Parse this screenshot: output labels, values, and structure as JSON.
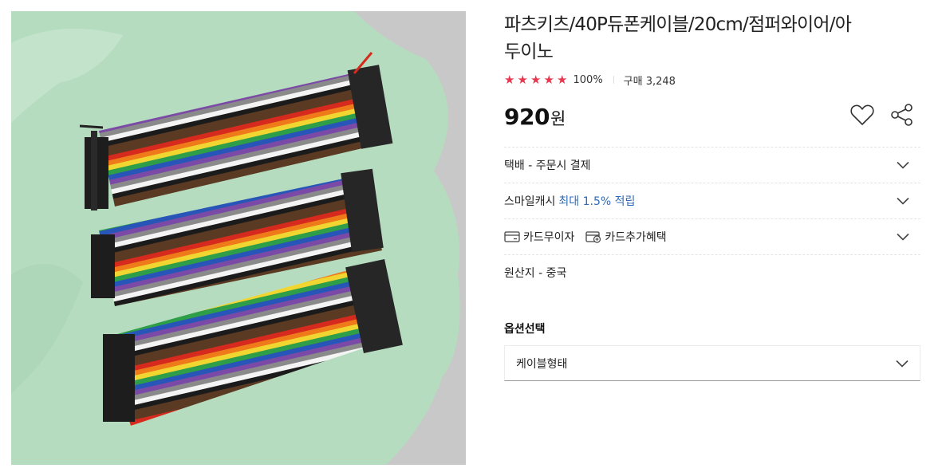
{
  "product": {
    "title_line1": "파츠키츠/40P듀폰케이블/20cm/점퍼와이어/아",
    "title_line2": "두이노",
    "stars": [
      "★",
      "★",
      "★",
      "★",
      "★"
    ],
    "rating_text": "100%",
    "purchases_text": "구매 3,248",
    "price_value": "920",
    "price_unit": "원"
  },
  "rows": {
    "delivery": "택배 - 주문시 결제",
    "smilecash_label": "스마일캐시",
    "smilecash_highlight": "최대 1.5% 적립",
    "card_installment": "카드무이자",
    "card_benefit": "카드추가혜택",
    "origin": "원산지 - 중국"
  },
  "options": {
    "title": "옵션선택",
    "select_placeholder": "케이블형태"
  },
  "icons": {
    "heart": "heart-icon",
    "share": "share-icon",
    "chevron": "chevron-down-icon",
    "card": "card-icon",
    "card_plus": "card-plus-icon"
  },
  "colors": {
    "star": "#e8384f",
    "highlight": "#2e6ab8",
    "photo_green": "#b6dcc0",
    "photo_gray": "#c8c8c8"
  }
}
